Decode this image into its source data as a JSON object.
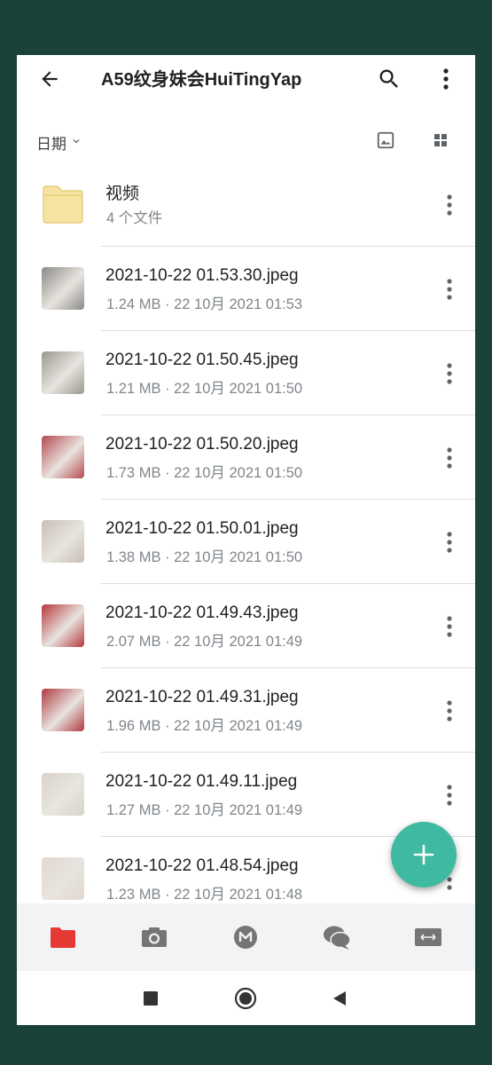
{
  "header": {
    "title": "A59纹身妹会HuiTingYap",
    "back_icon": "arrow-back-icon",
    "search_icon": "search-icon",
    "more_icon": "more-vert-icon"
  },
  "sortbar": {
    "sort_label": "日期",
    "view_image_icon": "image-view-icon",
    "view_grid_icon": "grid-view-icon"
  },
  "folder": {
    "name": "视频",
    "meta": "4 个文件",
    "icon": "folder-icon"
  },
  "files": [
    {
      "name": "2021-10-22 01.53.30.jpeg",
      "meta": "1.24 MB · 22 10月 2021 01:53",
      "thumb_color": "#8b8a86"
    },
    {
      "name": "2021-10-22 01.50.45.jpeg",
      "meta": "1.21 MB · 22 10月 2021 01:50",
      "thumb_color": "#9a9690"
    },
    {
      "name": "2021-10-22 01.50.20.jpeg",
      "meta": "1.73 MB · 22 10月 2021 01:50",
      "thumb_color": "#b4494f"
    },
    {
      "name": "2021-10-22 01.50.01.jpeg",
      "meta": "1.38 MB · 22 10月 2021 01:50",
      "thumb_color": "#c8bfb7"
    },
    {
      "name": "2021-10-22 01.49.43.jpeg",
      "meta": "2.07 MB · 22 10月 2021 01:49",
      "thumb_color": "#b6373b"
    },
    {
      "name": "2021-10-22 01.49.31.jpeg",
      "meta": "1.96 MB · 22 10月 2021 01:49",
      "thumb_color": "#b0393f"
    },
    {
      "name": "2021-10-22 01.49.11.jpeg",
      "meta": "1.27 MB · 22 10月 2021 01:49",
      "thumb_color": "#d9d3cc"
    },
    {
      "name": "2021-10-22 01.48.54.jpeg",
      "meta": "1.23 MB · 22 10月 2021 01:48",
      "thumb_color": "#e1d8d2"
    }
  ],
  "fab": {
    "icon": "add-icon",
    "color": "#3fbaa0"
  },
  "bottom_nav": [
    {
      "icon": "folder-icon",
      "active": true,
      "color": "#e53935"
    },
    {
      "icon": "camera-icon",
      "active": false
    },
    {
      "icon": "mega-icon",
      "active": false
    },
    {
      "icon": "chat-icon",
      "active": false
    },
    {
      "icon": "transfers-icon",
      "active": false
    }
  ],
  "system_nav": [
    {
      "icon": "recents-icon"
    },
    {
      "icon": "home-icon"
    },
    {
      "icon": "back-triangle-icon"
    }
  ]
}
